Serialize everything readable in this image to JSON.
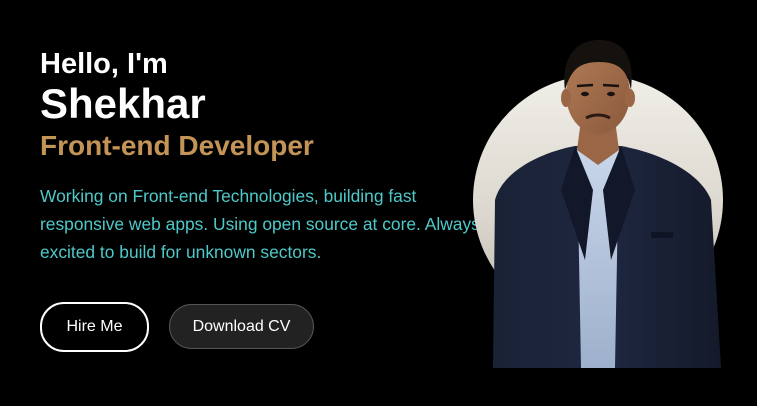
{
  "hero": {
    "greeting": "Hello, I'm",
    "name": "Shekhar",
    "role": "Front-end Developer",
    "description": "Working on Front-end Technologies, building fast responsive web apps. Using open source at core. Always excited to build for unknown sectors."
  },
  "buttons": {
    "hire_label": "Hire Me",
    "cv_label": "Download CV"
  },
  "colors": {
    "background": "#000000",
    "heading": "#ffffff",
    "role": "#c39456",
    "description": "#4ec9c9",
    "portrait_backdrop": "#e4e1da"
  },
  "portrait": {
    "subject": "man in dark suit jacket and light blue shirt"
  }
}
